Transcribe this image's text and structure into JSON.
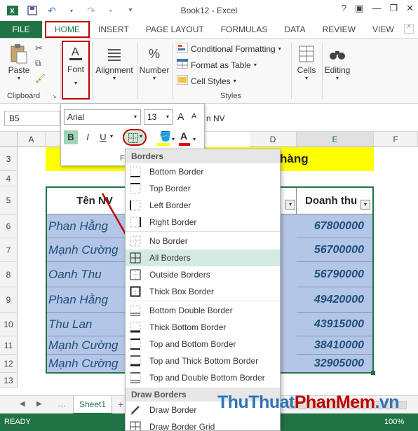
{
  "window": {
    "title": "Book12 - Excel",
    "help": "?",
    "minimize": "—",
    "restore": "❐",
    "close": "✕"
  },
  "tabs": [
    "FILE",
    "HOME",
    "INSERT",
    "PAGE LAYOUT",
    "FORMULAS",
    "DATA",
    "REVIEW",
    "VIEW"
  ],
  "ribbon": {
    "paste": "Paste",
    "clipboard": "Clipboard",
    "font": "Font",
    "alignment": "Alignment",
    "number": "Number",
    "conditional_formatting": "Conditional Formatting",
    "format_as_table": "Format as Table",
    "cell_styles": "Cell Styles",
    "styles": "Styles",
    "cells": "Cells",
    "editing": "Editing"
  },
  "formula_bar": {
    "name_box": "B5",
    "content": "n NV"
  },
  "mini_toolbar": {
    "font_name": "Arial",
    "font_size": "13",
    "bold": "B",
    "italic": "I",
    "underline": "U",
    "grow": "A",
    "shrink": "A",
    "font_color": "A",
    "partial_label": "Fo"
  },
  "grid": {
    "columns": [
      "A",
      "D",
      "E",
      "F"
    ],
    "rows": [
      "3",
      "4",
      "5",
      "6",
      "7",
      "8",
      "9",
      "10",
      "11",
      "12",
      "13"
    ],
    "banner_text": "hàng",
    "header_name": "Tên NV",
    "header_revenue": "Doanh thu",
    "names": [
      "Phan Hằng",
      "Mạnh Cường",
      "Oanh Thu",
      "Phan Hằng",
      "Thu Lan",
      "Mạnh Cường",
      "Mạnh Cường"
    ],
    "revenues": [
      "67800000",
      "56700000",
      "56790000",
      "49420000",
      "43915000",
      "38410000",
      "32905000"
    ]
  },
  "borders_menu": {
    "section_borders": "Borders",
    "items": [
      "Bottom Border",
      "Top Border",
      "Left Border",
      "Right Border",
      "No Border",
      "All Borders",
      "Outside Borders",
      "Thick Box Border",
      "Bottom Double Border",
      "Thick Bottom Border",
      "Top and Bottom Border",
      "Top and Thick Bottom Border",
      "Top and Double Bottom Border"
    ],
    "selected": "All Borders",
    "section_draw": "Draw Borders",
    "draw_items": [
      "Draw Border",
      "Draw Border Grid"
    ]
  },
  "sheet": {
    "tab": "Sheet1",
    "add": "+"
  },
  "status": {
    "ready": "READY",
    "zoom": "100%"
  },
  "watermark": {
    "part1": "ThuThuat",
    "part2": "PhanMem",
    "part3": ".vn"
  },
  "colors": {
    "excel_green": "#217346",
    "highlight_red": "#c00000",
    "banner_yellow": "#ffff00",
    "table_blue": "#b4c6e7",
    "menu_selected": "#d3ebe0"
  }
}
